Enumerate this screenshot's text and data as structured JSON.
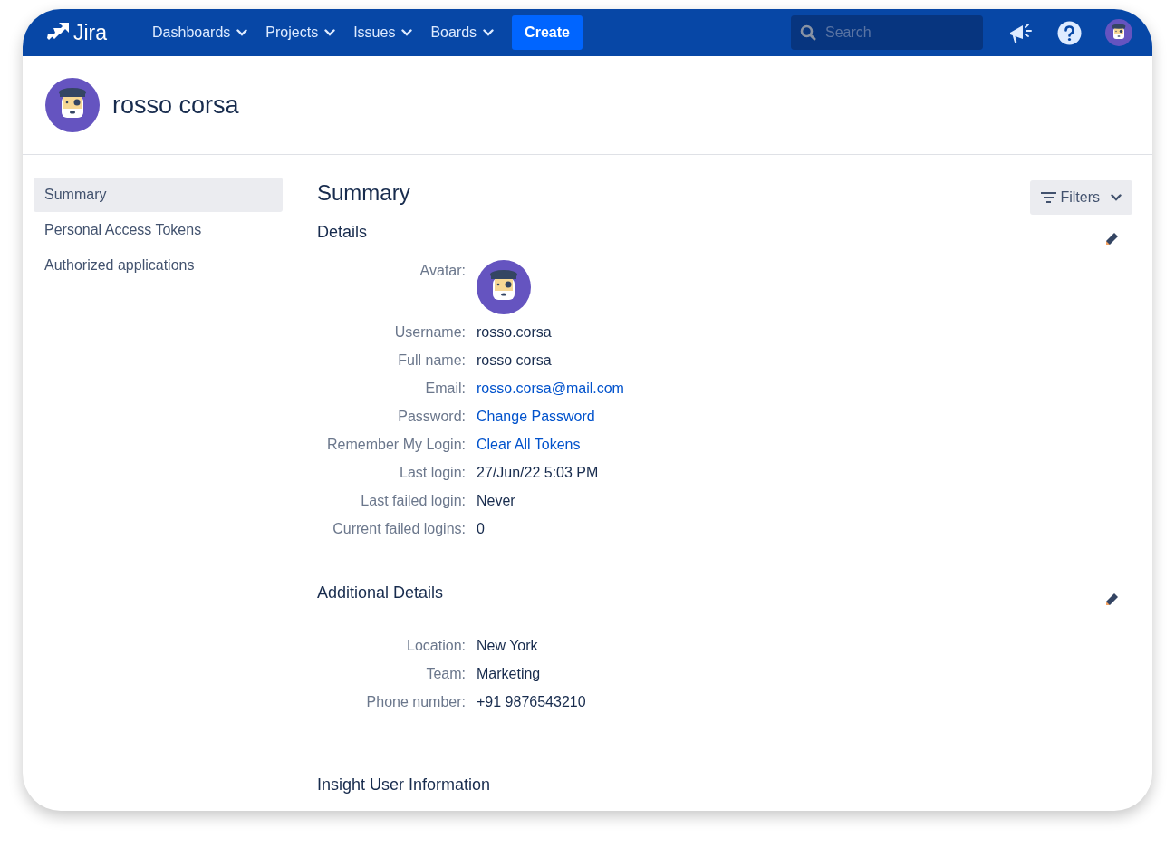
{
  "navbar": {
    "logo": "Jira",
    "menus": [
      {
        "label": "Dashboards"
      },
      {
        "label": "Projects"
      },
      {
        "label": "Issues"
      },
      {
        "label": "Boards"
      }
    ],
    "create_button": "Create",
    "search": {
      "placeholder": "Search"
    }
  },
  "profile": {
    "name": "rosso corsa"
  },
  "sidebar": {
    "items": [
      {
        "label": "Summary",
        "selected": true
      },
      {
        "label": "Personal Access Tokens",
        "selected": false
      },
      {
        "label": "Authorized applications",
        "selected": false
      }
    ]
  },
  "main": {
    "title": "Summary",
    "filters_button": "Filters",
    "sections": [
      {
        "title": "Details",
        "editable": true,
        "fields": [
          {
            "label": "Avatar:",
            "kind": "avatar"
          },
          {
            "label": "Username:",
            "kind": "text",
            "value": "rosso.corsa"
          },
          {
            "label": "Full name:",
            "kind": "text",
            "value": "rosso corsa"
          },
          {
            "label": "Email:",
            "kind": "link",
            "value": "rosso.corsa@mail.com"
          },
          {
            "label": "Password:",
            "kind": "link",
            "value": "Change Password"
          },
          {
            "label": "Remember My Login:",
            "kind": "link",
            "value": "Clear All Tokens"
          },
          {
            "label": "Last login:",
            "kind": "text",
            "value": "27/Jun/22 5:03 PM"
          },
          {
            "label": "Last failed login:",
            "kind": "text",
            "value": "Never"
          },
          {
            "label": "Current failed logins:",
            "kind": "text",
            "value": "0"
          }
        ]
      },
      {
        "title": "Additional Details",
        "editable": true,
        "fields": [
          {
            "label": "Location:",
            "kind": "text",
            "value": "New York"
          },
          {
            "label": "Team:",
            "kind": "text",
            "value": "Marketing"
          },
          {
            "label": "Phone number:",
            "kind": "text",
            "value": "+91 9876543210"
          }
        ]
      },
      {
        "title": "Insight User Information",
        "editable": false
      }
    ]
  }
}
